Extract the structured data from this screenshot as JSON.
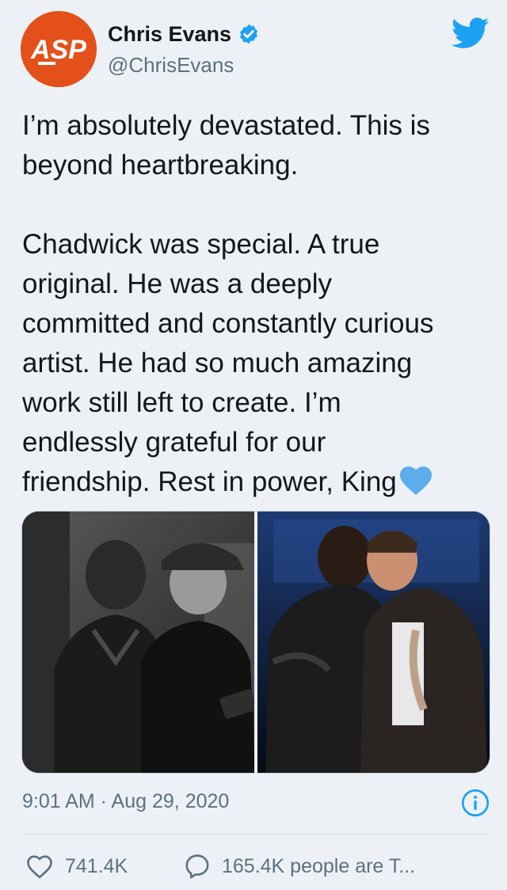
{
  "author": {
    "display_name": "Chris Evans",
    "handle": "@ChrisEvans",
    "avatar_text": "ASP",
    "avatar_color": "#e4501a",
    "verified": true
  },
  "tweet": {
    "text": "I’m absolutely devastated. This is\nbeyond heartbreaking.\n\nChadwick was special. A true\noriginal. He was a deeply\ncommitted and constantly curious\nartist. He had so much amazing\nwork still left to create. I’m\nendlessly grateful for our\nfriendship. Rest in power, King",
    "emoji": "blue-heart"
  },
  "media": [
    {
      "icon": "photo-black-and-white"
    },
    {
      "icon": "photo-stage-embrace"
    }
  ],
  "meta": {
    "timestamp": "9:01 AM · Aug 29, 2020"
  },
  "actions": {
    "likes": "741.4K",
    "talking": "165.4K people are T..."
  },
  "colors": {
    "background": "#edf1f5",
    "twitter_blue": "#1da1f2",
    "secondary_text": "#5b7083"
  }
}
